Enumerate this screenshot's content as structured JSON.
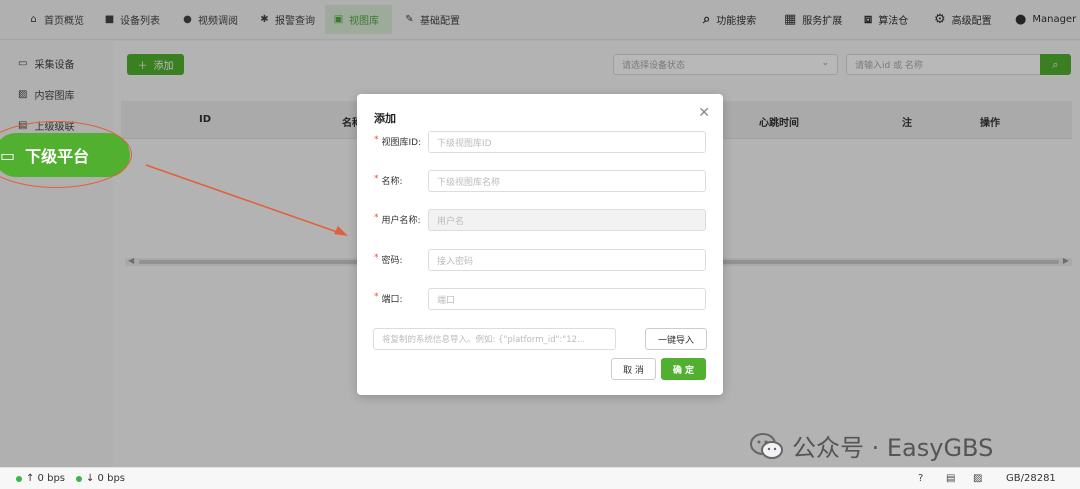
{
  "nav": {
    "items": [
      {
        "icon": "home-icon",
        "label": "首页概览"
      },
      {
        "icon": "camera-icon",
        "label": "设备列表"
      },
      {
        "icon": "video-play-icon",
        "label": "视频调阅"
      },
      {
        "icon": "alarm-bug-icon",
        "label": "报警查询"
      },
      {
        "icon": "image-library-icon",
        "label": "视图库"
      },
      {
        "icon": "pencil-icon",
        "label": "基础配置"
      }
    ],
    "active_index": 4,
    "right": [
      {
        "icon": "search-icon",
        "label": "功能搜索"
      },
      {
        "icon": "grid-icon",
        "label": "服务扩展"
      },
      {
        "icon": "box-icon",
        "label": "算法仓"
      },
      {
        "icon": "gear-icon",
        "label": "高级配置"
      },
      {
        "icon": "user-icon",
        "label": "Manager"
      }
    ]
  },
  "sidebar": {
    "items": [
      {
        "icon": "device-icon",
        "label": "采集设备"
      },
      {
        "icon": "picture-icon",
        "label": "内容图库"
      },
      {
        "icon": "folder-icon",
        "label": "上级级联"
      }
    ],
    "highlight": {
      "icon": "monitor-icon",
      "label": "下级平台"
    }
  },
  "toolbar": {
    "add_label": "添加",
    "status_placeholder": "请选择设备状态",
    "search_placeholder": "请输入id 或 名称"
  },
  "table": {
    "columns": [
      "ID",
      "名称",
      "心跳时间",
      "注",
      "操作"
    ]
  },
  "dialog": {
    "title": "添加",
    "fields": [
      {
        "label": "视图库ID:",
        "placeholder": "下级视图库ID"
      },
      {
        "label": "名称:",
        "placeholder": "下级视图库名称"
      },
      {
        "label": "用户名称:",
        "placeholder": "用户名"
      },
      {
        "label": "密码:",
        "placeholder": "接入密码"
      },
      {
        "label": "端口:",
        "placeholder": "端口"
      }
    ],
    "paste_placeholder": "将复制的系统信息导入。例如: {\"platform_id\":\"12...",
    "import_label": "一键导入",
    "cancel_label": "取 消",
    "ok_label": "确 定"
  },
  "watermark": {
    "text": "公众号 · EasyGBS"
  },
  "status": {
    "up": "↑ 0 bps",
    "down": "↓ 0 bps",
    "right_text": "GB/28281"
  },
  "colors": {
    "accent": "#52b031",
    "annotation": "#e0603b"
  }
}
